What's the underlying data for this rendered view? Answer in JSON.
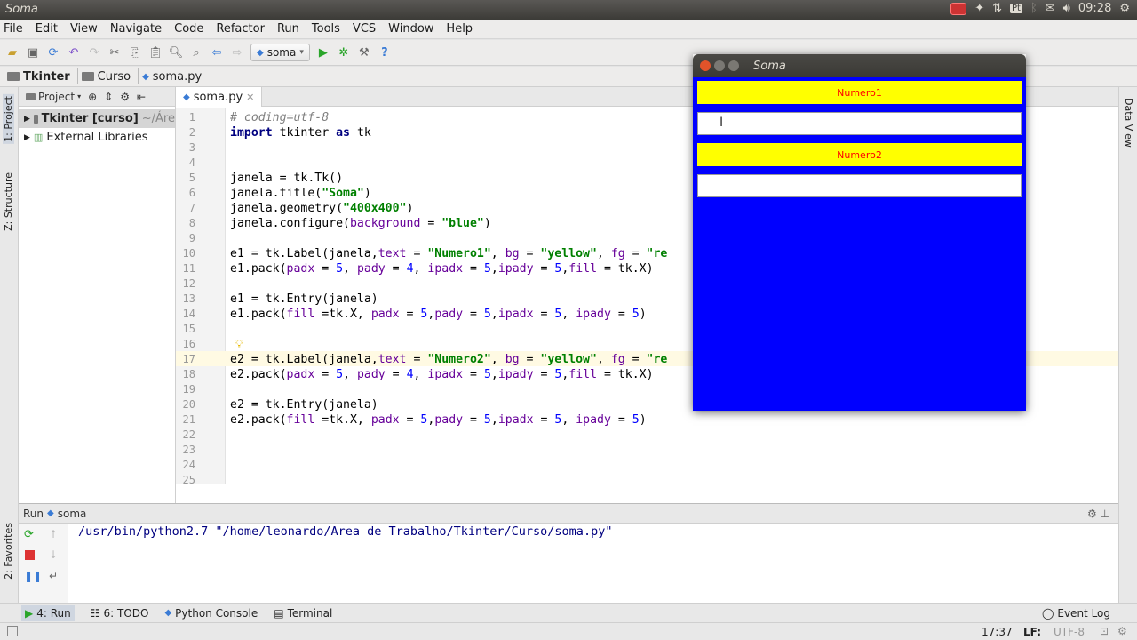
{
  "os": {
    "window_title": "Soma",
    "clock": "09:28",
    "keyboard_layout": "Pt"
  },
  "menu": [
    "File",
    "Edit",
    "View",
    "Navigate",
    "Code",
    "Refactor",
    "Run",
    "Tools",
    "VCS",
    "Window",
    "Help"
  ],
  "toolbar": {
    "run_config": "soma"
  },
  "breadcrumb": [
    "Tkinter",
    "Curso",
    "soma.py"
  ],
  "project_panel": {
    "title": "Project",
    "root": "Tkinter [curso]",
    "root_path": "~/Áre",
    "external": "External Libraries"
  },
  "side_tabs": {
    "project": "1: Project",
    "structure": "Z: Structure",
    "favorites": "2: Favorites",
    "data_view": "Data View"
  },
  "editor": {
    "tab": "soma.py",
    "line_numbers": [
      "1",
      "2",
      "3",
      "4",
      "5",
      "6",
      "7",
      "8",
      "9",
      "10",
      "11",
      "12",
      "13",
      "14",
      "15",
      "16",
      "17",
      "18",
      "19",
      "20",
      "21",
      "22",
      "23",
      "24",
      "25"
    ]
  },
  "run": {
    "label": "Run",
    "config": "soma",
    "output": "/usr/bin/python2.7 \"/home/leonardo/Area de Trabalho/Tkinter/Curso/soma.py\""
  },
  "bottom_tabs": [
    "4: Run",
    "6: TODO",
    "Python Console",
    "Terminal"
  ],
  "event_log": "Event Log",
  "status": {
    "position": "17:37",
    "line_sep": "LF:",
    "encoding": "UTF-8"
  },
  "tk_window": {
    "title": "Soma",
    "label1": "Numero1",
    "label2": "Numero2"
  }
}
